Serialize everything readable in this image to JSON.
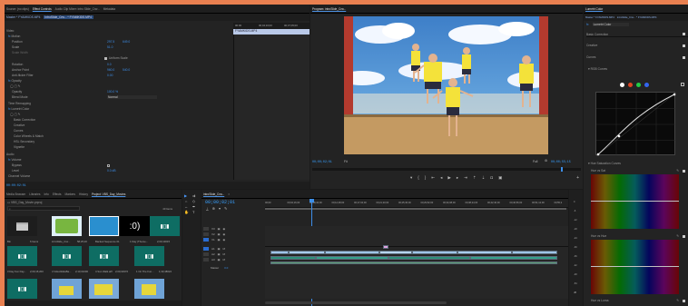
{
  "source_monitor": {
    "tab": "Source: (no clips)"
  },
  "effect_controls": {
    "tab": "Effect Controls",
    "tab_audio_mixer": "Audio Clip Mixer: intro Slide_Crw...",
    "tab_metadata": "Metadata",
    "menu_icon": "hamburger-icon",
    "clip_path": "Master * FYAMKIDS.MP4",
    "clip_seq": "introSlide_Crw... * FYAMKIDS.MP4",
    "video_label": "Video",
    "motion": "Motion",
    "position": "Position",
    "position_x": "297.5",
    "position_y": "649.0",
    "scale": "Scale",
    "scale_val": "51.0",
    "scale_width": "Scale Width",
    "uniform": "Uniform Scale",
    "rotation": "Rotation",
    "rotation_val": "0.0",
    "anchor": "Anchor Point",
    "anchor_x": "960.0",
    "anchor_y": "540.0",
    "anti_flicker": "Anti-flicker Filter",
    "anti_flicker_val": "0.00",
    "opacity": "Opacity",
    "opacity_pct": "Opacity",
    "opacity_val": "100.0 %",
    "blend": "Blend Mode",
    "blend_val": "Normal",
    "time_remap": "Time Remapping",
    "lumetri": "Lumetri Color",
    "basic": "Basic Correction",
    "creative": "Creative",
    "curves": "Curves",
    "color_wheels": "Color Wheels & Match",
    "hsl": "HSL Secondary",
    "vignette": "Vignette",
    "audio_label": "Audio",
    "volume": "Volume",
    "bypass": "Bypass",
    "level": "Level",
    "level_val": "0.0 dB",
    "channel_vol": "Channel Volume",
    "timecode": "00:00:02:01",
    "ruler_t1": "00:00",
    "ruler_t2": "00;04;16;00",
    "ruler_t3": "00;37;05;00",
    "clip_name": "FYAMKIDS.MP4"
  },
  "program": {
    "tab": "Program: introSlide_Crw...",
    "timecode": "00;00;02;01",
    "fit": "Fit",
    "quality": "Full",
    "duration": "00;00;55;15"
  },
  "lumetri_panel": {
    "tab": "Lumetri Color",
    "path": "Master * FYAMKIDS.MP4",
    "seq": "introSlide_Crw... * FYAMKIDS.MP4",
    "fx": "fx",
    "effect": "Lumetri Color",
    "basic": "Basic Correction",
    "creative": "Creative",
    "curves": "Curves",
    "rgb_curves": "RGB Curves",
    "hue_sat": "Hue Saturation Curves",
    "hue_vs_sat": "Hue vs Sat",
    "hue_vs_hue": "Hue vs Hue",
    "hue_vs_luma": "Hue vs Luma"
  },
  "project": {
    "tabs": [
      "Media Browser",
      "Libraries",
      "Info",
      "Effects",
      "Markers",
      "History",
      "Project: VBS_Day_Movies"
    ],
    "project_file": "VBS_Day_Movie.prproj",
    "items_count": "40 Items",
    "items": [
      {
        "name": "Bin",
        "meta": "6 Items"
      },
      {
        "name": "introSlide_Crw...",
        "meta": "58;25;20"
      },
      {
        "name": "Backed Sequence 01",
        "meta": "40;12"
      },
      {
        "name": "1 Day (Theme...",
        "meta": "2;00;10015"
      },
      {
        "name": "3 Day Fun Day...",
        "meta": "2;00;15;200"
      },
      {
        "name": "4 VideoSlideBa...",
        "meta": "2;13;01000"
      },
      {
        "name": "4 Sun Walk.aiff",
        "meta": "2;00;02976"
      },
      {
        "name": "1 On The Fun...",
        "meta": "1;33;48022"
      }
    ],
    "still_text": ":0)"
  },
  "timeline": {
    "tab": "introSlide_Crw...",
    "timecode": "00;00;02;01",
    "ruler": [
      "00;00",
      "00;04;16;00",
      "00;08;32;00",
      "00;12;48;00",
      "00;17;04;00",
      "00;21;20;00",
      "00;25;36;00",
      "00;29;52;00",
      "00;34;08;00",
      "00;38;24;00",
      "00;42;40;00",
      "00;46;56;00",
      "00;51;12;00",
      "00;55;2"
    ],
    "tracks": [
      "V3",
      "V2",
      "V1",
      "A1",
      "A2",
      "A3"
    ],
    "master": "Master",
    "master_val": "0.0"
  },
  "meter": {
    "labels": [
      "0",
      "-6",
      "-12",
      "-18",
      "-24",
      "-30",
      "-36",
      "-42",
      "-48",
      "-54",
      "dB"
    ]
  }
}
